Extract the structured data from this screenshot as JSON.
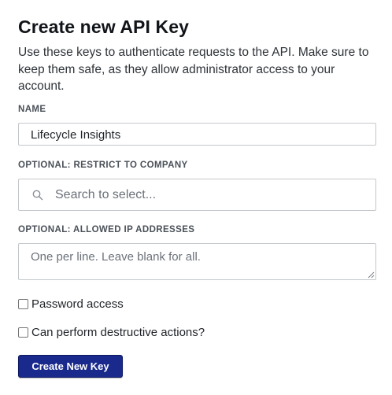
{
  "dialog": {
    "title": "Create new API Key",
    "description": "Use these keys to authenticate requests to the API. Make sure to keep them safe, as they allow administrator access to your account."
  },
  "name_field": {
    "label": "NAME",
    "value": "Lifecycle Insights"
  },
  "company_field": {
    "label": "OPTIONAL: RESTRICT TO COMPANY",
    "placeholder": "Search to select...",
    "icon": "search-icon"
  },
  "ip_field": {
    "label": "OPTIONAL: ALLOWED IP ADDRESSES",
    "placeholder": "One per line. Leave blank for all."
  },
  "checkboxes": [
    {
      "label": "Password access",
      "checked": false
    },
    {
      "label": "Can perform destructive actions?",
      "checked": false
    }
  ],
  "submit": {
    "label": "Create New Key",
    "color": "#1a2a8c"
  }
}
